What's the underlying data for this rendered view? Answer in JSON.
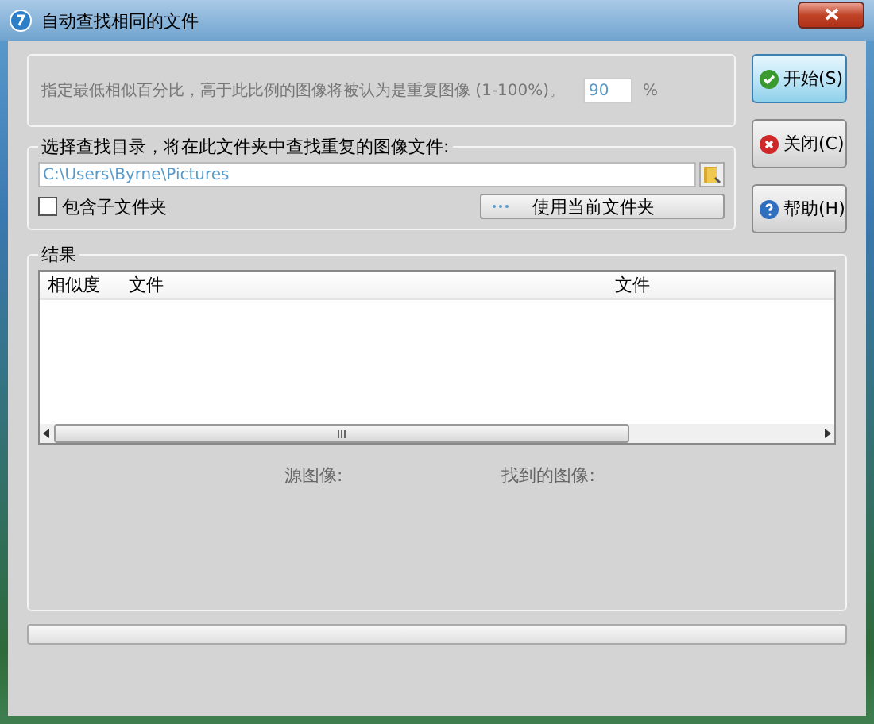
{
  "window": {
    "title": "自动查找相同的文件"
  },
  "threshold": {
    "label": "指定最低相似百分比，高于此比例的图像将被认为是重复图像 (1-100%)。",
    "value": "90",
    "unit": "%"
  },
  "directory": {
    "label": "选择查找目录，将在此文件夹中查找重复的图像文件:",
    "path": "C:\\Users\\Byrne\\Pictures",
    "include_subfolders": {
      "label": "包含子文件夹",
      "checked": false
    },
    "use_current_button": "使用当前文件夹"
  },
  "results": {
    "label": "结果",
    "columns": [
      "相似度",
      "文件",
      "文件"
    ],
    "source_label": "源图像:",
    "found_label": "找到的图像:"
  },
  "progress": {
    "level": 0
  },
  "buttons": [
    {
      "kind": "start",
      "label": "开始(S)",
      "focused": true
    },
    {
      "kind": "close",
      "label": "关闭(C)",
      "focused": false
    },
    {
      "kind": "help",
      "label": "帮助(H)",
      "focused": false
    }
  ]
}
